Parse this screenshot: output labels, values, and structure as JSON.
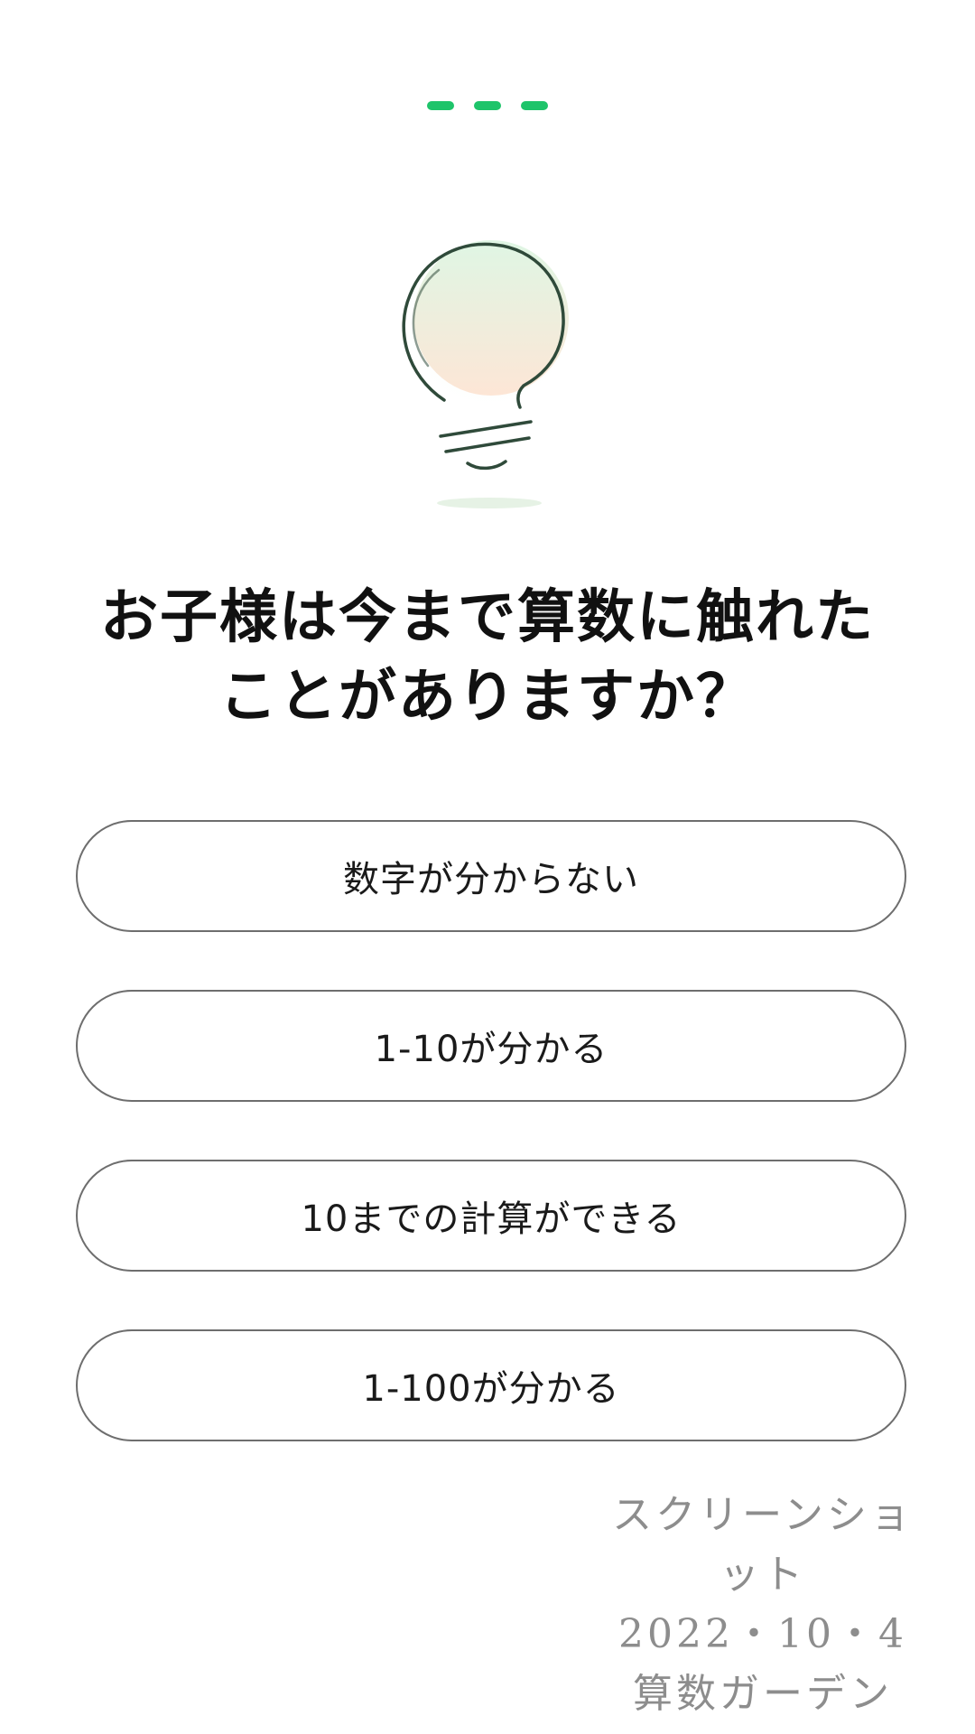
{
  "progress": {
    "total_steps": 3,
    "completed_steps": 3,
    "color": "#1ec46a"
  },
  "illustration": {
    "icon": "lightbulb-icon"
  },
  "question": {
    "line1": "お子様は今まで算数に触れた",
    "line2": "ことがありますか？"
  },
  "options": [
    {
      "label": "数字が分からない"
    },
    {
      "label": "1-10が分かる"
    },
    {
      "label": "10までの計算ができる"
    },
    {
      "label": "1-100が分かる"
    }
  ],
  "stamp": {
    "line1": "スクリーンショット",
    "line2": "2022・10・4",
    "line3": "算数ガーデン"
  }
}
